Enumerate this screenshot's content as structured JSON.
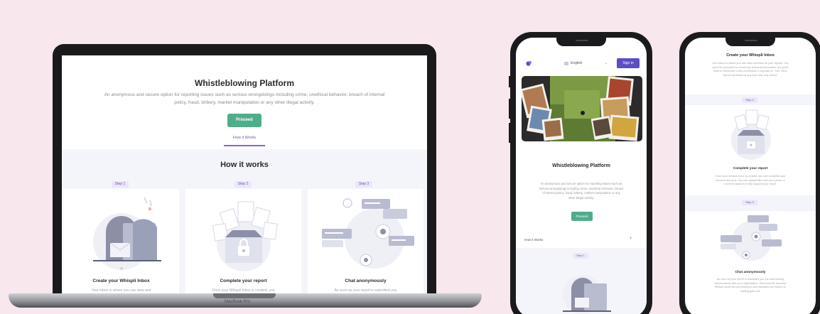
{
  "colors": {
    "page_background": "#f9e7ee",
    "accent_green": "#4fae8a",
    "accent_purple": "#6e5ca5",
    "sign_in_blue": "#5b4fc2",
    "section_background": "#f4f5fb",
    "step_badge": "#ece6fa"
  },
  "laptop": {
    "title": "Whistleblowing Platform",
    "subtitle_line1": "An anonymous and secure option for reporting issues such as serious wrongdoings including crime, unethical behavior, breach of internal",
    "subtitle_line2": "policy, fraud, bribery, market manipulation or any other illegal activity.",
    "proceed_button": "Proceed",
    "how_link": "How it Works",
    "section_title": "How it works",
    "base_label": "MacBook Pro",
    "steps": [
      {
        "badge": "Step 1",
        "title": "Create your Whispli Inbox",
        "text": "Your Inbox is where you can view and",
        "icon": "mailbox-icon"
      },
      {
        "badge": "Step 2",
        "title": "Complete your report",
        "text": "Once your Whispli Inbox is created, you",
        "icon": "lock-document-icon"
      },
      {
        "badge": "Step 3",
        "title": "Chat anonymously",
        "text": "As soon as your report is submitted you",
        "icon": "chat-bubbles-icon"
      }
    ]
  },
  "phone1": {
    "language": "English",
    "sign_in": "Sign in",
    "title": "Whistleblowing Platform",
    "subtitle_lines": [
      "An anonymous and secure option for reporting issues such as",
      "serious wrongdoings including crime, unethical behavior, breach",
      "of internal policy, fraud, bribery, market manipulation or any",
      "other illegal activity."
    ],
    "proceed_button": "Proceed",
    "how_link": "How it Works",
    "step_badge": "Step 1"
  },
  "phone2": {
    "top_title": "Create your Whispli Inbox",
    "top_text_lines": [
      "Your Inbox is where you can view and track all your reports. You",
      "won't be prompted to reveal any personal information, but you'll",
      "need to remember a few credentials to log back in. Your Inbox",
      "can be accessed at any time from any device."
    ],
    "step2": {
      "badge": "Step 2",
      "title": "Complete your report",
      "lines": [
        "Once your Whispli Inbox is created, you can complete your",
        "report at any time. You can upload files such as a photo or",
        "a screen capture to help support your report."
      ]
    },
    "step3": {
      "badge": "Step 3",
      "title": "Chat anonymously",
      "lines": [
        "As soon as your report is submitted you can start having",
        "conversations with your organization. Send and file securely.",
        "Whispli saves all conversations and maintains full history so",
        "nothing gets lost."
      ]
    }
  }
}
